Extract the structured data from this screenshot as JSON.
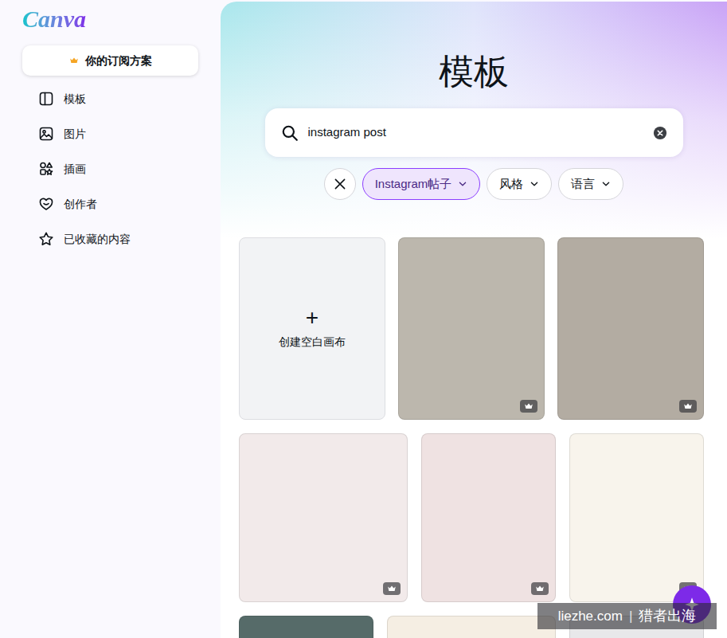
{
  "logo": "Canva",
  "subscription": {
    "label": "你的订阅方案"
  },
  "sidebar": {
    "items": [
      {
        "label": "模板"
      },
      {
        "label": "图片"
      },
      {
        "label": "插画"
      },
      {
        "label": "创作者"
      },
      {
        "label": "已收藏的内容"
      }
    ]
  },
  "page": {
    "title": "模板"
  },
  "search": {
    "value": "instagram post"
  },
  "filters": [
    {
      "label": "Instagram帖子",
      "selected": true
    },
    {
      "label": "风格",
      "selected": false
    },
    {
      "label": "语言",
      "selected": false
    }
  ],
  "blank_canvas": {
    "icon": "+",
    "label": "创建空白画布"
  },
  "templates": [
    {
      "premium": true,
      "color": "#bcb7ad"
    },
    {
      "premium": true,
      "color": "#b3aca2"
    },
    {
      "premium": true,
      "color": "#f2eaea"
    },
    {
      "premium": true,
      "color": "#efe2e2"
    },
    {
      "premium": true,
      "color": "#f8f4ec"
    },
    {
      "color": "#566b69"
    },
    {
      "color": "#f5eee3"
    },
    {
      "color": "#e8e8ea"
    }
  ],
  "watermark": {
    "site": "liezhe.com",
    "separator": "|",
    "brand": "猎者出海"
  }
}
